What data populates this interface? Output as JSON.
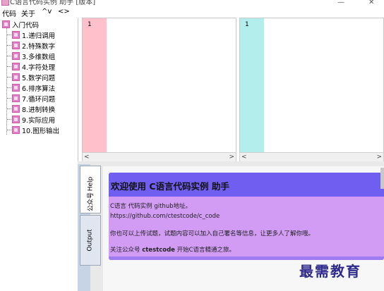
{
  "window": {
    "title": "C语言代码实例 助手 [版本]"
  },
  "menu": [
    {
      "label": "代码"
    },
    {
      "label": "关于"
    },
    {
      "label": "^v"
    },
    {
      "label": "<>"
    }
  ],
  "tree": {
    "root": "入门代码",
    "items": [
      "1.递归调用",
      "2.特殊数字",
      "3.多维数组",
      "4.字符处理",
      "5.数学问题",
      "6.排序算法",
      "7.循环问题",
      "8.进制转换",
      "9.实际应用",
      "10.图形输出"
    ]
  },
  "editors": {
    "left": {
      "line_number": "1",
      "gutter_color": "#ffc0cb"
    },
    "right": {
      "line_number": "1",
      "gutter_color": "#b3eeec"
    }
  },
  "scroll_arrows": {
    "left": "<",
    "right": ">"
  },
  "side_tabs": [
    "Help",
    "公众号",
    "Output"
  ],
  "welcome": {
    "title": "欢迎使用 C语言代码实例 助手",
    "line1": "C语言 代码实例 github地址。",
    "line2": "https://github.com/ctestcode/c_code",
    "line3": "你也可以上传试题，试题内容可以加入自己署名等信息，让更多人了解你哦。",
    "line4_prefix": "关注公众号 ",
    "line4_bold": "ctestcode",
    "line4_suffix": " 开始C语言精通之旅。"
  },
  "watermark": "最需教育",
  "colors": {
    "card_header": "#6f5ef0",
    "card_body": "#d29cf5",
    "tree_icon": "#e27fc6"
  }
}
